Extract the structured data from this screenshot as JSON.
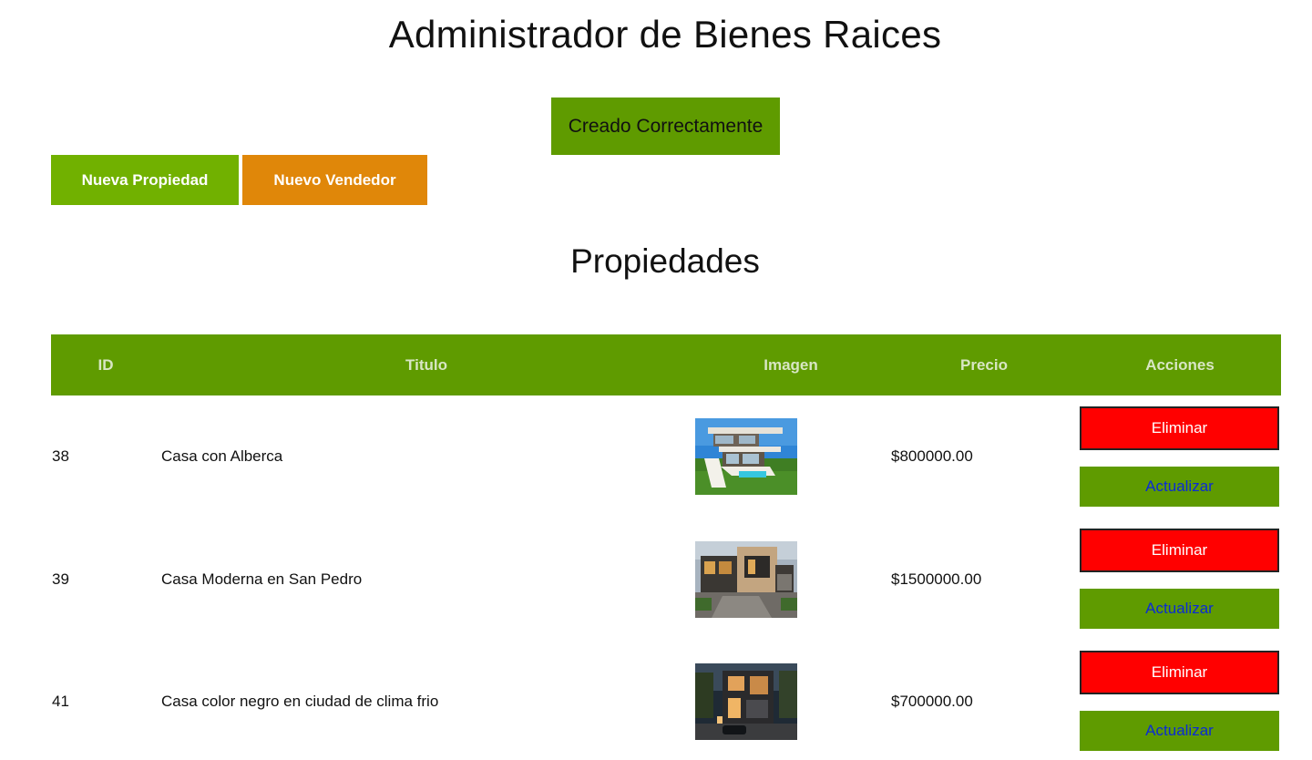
{
  "header": {
    "title": "Administrador de Bienes Raices"
  },
  "alert": {
    "message": "Creado Correctamente"
  },
  "actions": {
    "new_property_label": "Nueva Propiedad",
    "new_seller_label": "Nuevo Vendedor"
  },
  "section": {
    "title": "Propiedades"
  },
  "table": {
    "columns": [
      "ID",
      "Titulo",
      "Imagen",
      "Precio",
      "Acciones"
    ],
    "rows": [
      {
        "id": "38",
        "title": "Casa con Alberca",
        "image": "modern-house-with-pool-thumbnail",
        "price": "$800000.00",
        "delete_label": "Eliminar",
        "update_label": "Actualizar"
      },
      {
        "id": "39",
        "title": "Casa Moderna en San Pedro",
        "image": "modern-house-facade-thumbnail",
        "price": "$1500000.00",
        "delete_label": "Eliminar",
        "update_label": "Actualizar"
      },
      {
        "id": "41",
        "title": "Casa color negro en ciudad de clima frio",
        "image": "dark-house-at-dusk-thumbnail",
        "price": "$700000.00",
        "delete_label": "Eliminar",
        "update_label": "Actualizar"
      }
    ]
  },
  "colors": {
    "primary_green": "#5f9b00",
    "light_green": "#71b100",
    "orange": "#e08709",
    "red": "#ff0000",
    "link_blue": "#0a2bd6"
  }
}
